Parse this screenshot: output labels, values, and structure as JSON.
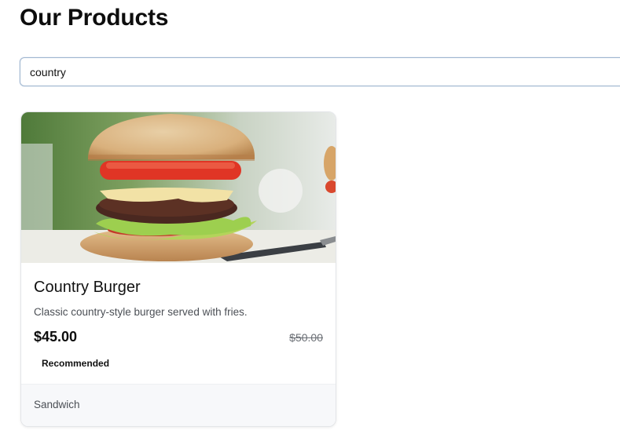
{
  "page": {
    "title": "Our Products"
  },
  "search": {
    "value": "country",
    "placeholder": ""
  },
  "products": [
    {
      "name": "Country Burger",
      "description": "Classic country-style burger served with fries.",
      "price": "$45.00",
      "original_price": "$50.00",
      "badge": "Recommended",
      "category": "Sandwich",
      "image_icon": "burger-photo"
    }
  ]
}
